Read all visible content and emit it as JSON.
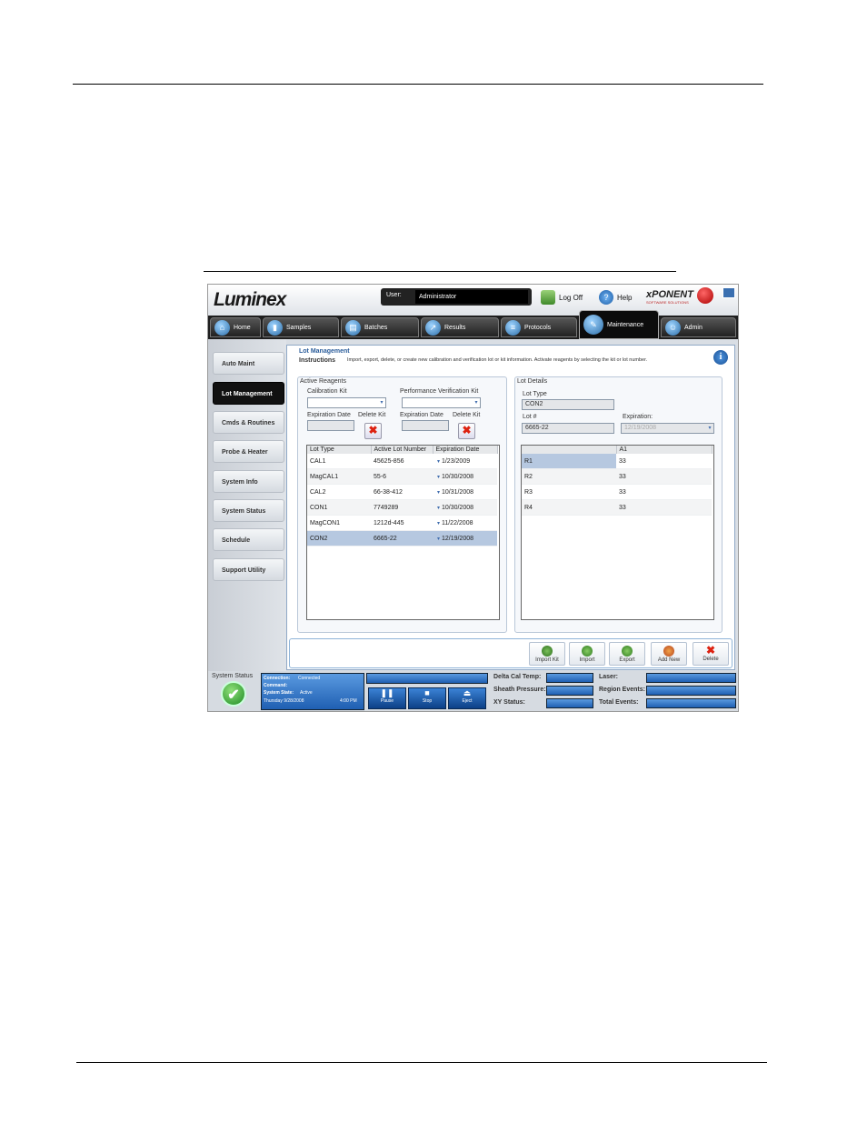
{
  "app": {
    "logo": "Luminex",
    "user_label": "User:",
    "user_value": "Administrator",
    "logoff_label": "Log Off",
    "help_label": "Help",
    "brand": "xPONENT",
    "brand_sub": "SOFTWARE SOLUTIONS"
  },
  "tabs": [
    {
      "label": "Home",
      "icon": "home-icon"
    },
    {
      "label": "Samples",
      "icon": "samples-icon"
    },
    {
      "label": "Batches",
      "icon": "batches-icon"
    },
    {
      "label": "Results",
      "icon": "results-icon"
    },
    {
      "label": "Protocols",
      "icon": "protocols-icon"
    },
    {
      "label": "Maintenance",
      "icon": "maintenance-icon",
      "active": true
    },
    {
      "label": "Admin",
      "icon": "admin-icon"
    }
  ],
  "sidebar": {
    "items": [
      {
        "label": "Auto Maint"
      },
      {
        "label": "Lot Management",
        "active": true
      },
      {
        "label": "Cmds & Routines"
      },
      {
        "label": "Probe & Heater"
      },
      {
        "label": "System Info"
      },
      {
        "label": "System Status"
      },
      {
        "label": "Schedule"
      },
      {
        "label": "Support Utility"
      }
    ]
  },
  "main": {
    "title": "Lot Management",
    "instructions_label": "Instructions",
    "instructions_text": "Import, export, delete, or create new calibration and verification lot or kit information. Activate reagents by selecting the kit or lot number.",
    "active_reagents": {
      "title": "Active Reagents",
      "calibration_kit_label": "Calibration Kit",
      "performance_kit_label": "Performance Verification Kit",
      "expiration_label": "Expiration Date",
      "delete_kit_label": "Delete Kit",
      "columns": [
        "Lot Type",
        "Active Lot Number",
        "Expiration Date"
      ],
      "rows": [
        {
          "type": "CAL1",
          "lot": "45625-856",
          "exp": "1/23/2009"
        },
        {
          "type": "MagCAL1",
          "lot": "55-6",
          "exp": "10/30/2008"
        },
        {
          "type": "CAL2",
          "lot": "66-38-412",
          "exp": "10/31/2008"
        },
        {
          "type": "CON1",
          "lot": "7749289",
          "exp": "10/30/2008"
        },
        {
          "type": "MagCON1",
          "lot": "1212d-445",
          "exp": "11/22/2008"
        },
        {
          "type": "CON2",
          "lot": "6665-22",
          "exp": "12/19/2008",
          "selected": true
        }
      ]
    },
    "lot_details": {
      "title": "Lot Details",
      "lot_type_label": "Lot Type",
      "lot_type_value": "CON2",
      "lot_num_label": "Lot #",
      "lot_num_value": "6665-22",
      "expiration_label": "Expiration:",
      "expiration_value": "12/19/2008",
      "columns": [
        "",
        "A1"
      ],
      "rows": [
        {
          "name": "R1",
          "value": "33",
          "selected": true
        },
        {
          "name": "R2",
          "value": "33"
        },
        {
          "name": "R3",
          "value": "33"
        },
        {
          "name": "R4",
          "value": "33"
        }
      ]
    },
    "actions": [
      "Import Kit",
      "Import",
      "Export",
      "Add New",
      "Delete"
    ]
  },
  "statusbar": {
    "system_status_label": "System Status",
    "connection_label": "Connection:",
    "connection_value": "Connected",
    "command_label": "Command:",
    "state_label": "System State:",
    "state_value": "Active",
    "date_value": "Thursday 9/28/2008",
    "time_value": "4:00 PM",
    "pause_label": "Pause",
    "stop_label": "Stop",
    "eject_label": "Eject",
    "delta_cal_label": "Delta Cal Temp:",
    "sheath_label": "Sheath Pressure:",
    "xy_label": "XY Status:",
    "laser_label": "Laser:",
    "region_label": "Region Events:",
    "total_label": "Total Events:"
  }
}
